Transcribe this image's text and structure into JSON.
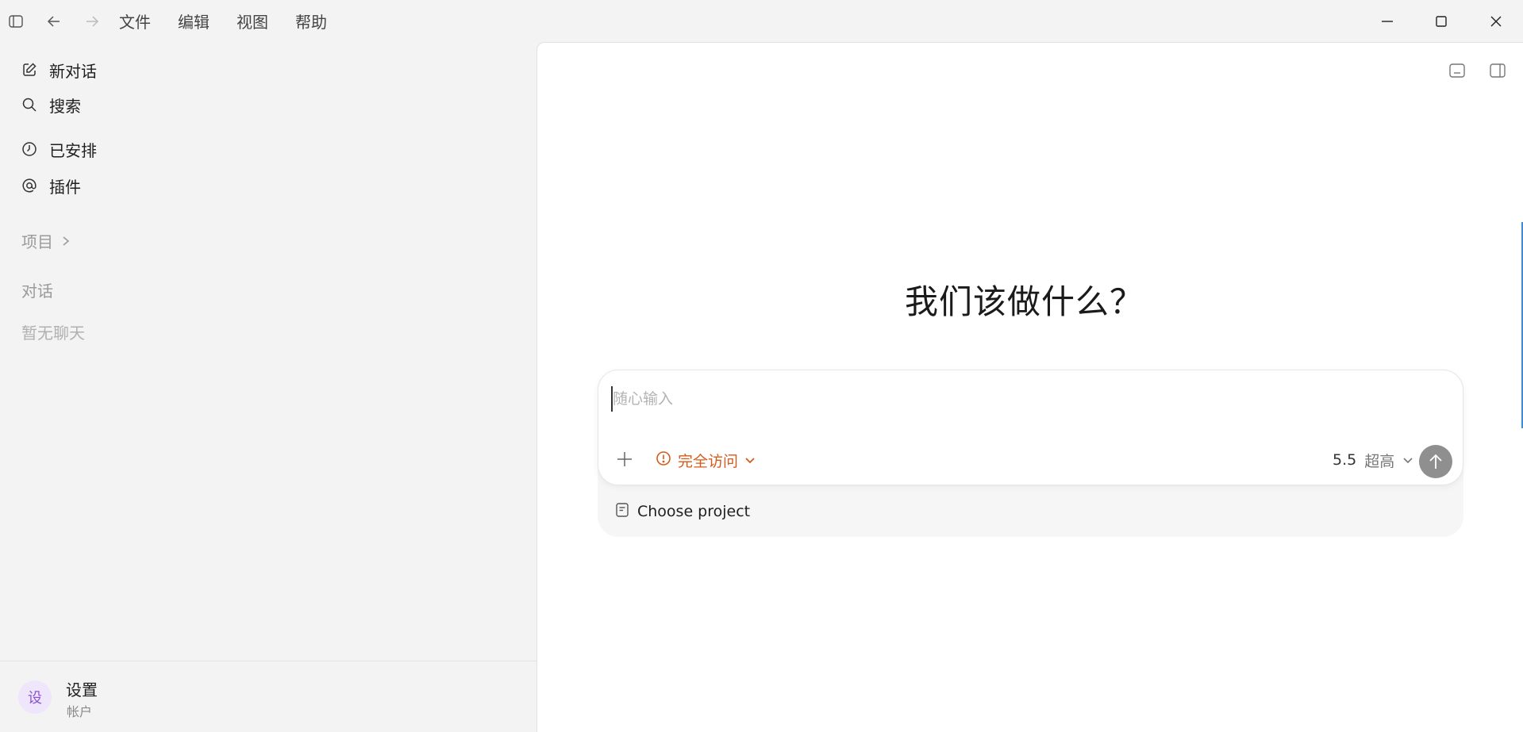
{
  "titlebar": {
    "menu": [
      "文件",
      "编辑",
      "视图",
      "帮助"
    ]
  },
  "sidebar": {
    "items": [
      {
        "label": "新对话",
        "icon": "edit-icon"
      },
      {
        "label": "搜索",
        "icon": "search-icon"
      },
      {
        "label": "已安排",
        "icon": "clock-icon"
      },
      {
        "label": "插件",
        "icon": "at-icon"
      }
    ],
    "projects_label": "项目",
    "conversations_label": "对话",
    "empty_label": "暂无聊天",
    "footer": {
      "avatar_text": "设",
      "title": "设置",
      "subtitle": "帐户"
    }
  },
  "main": {
    "heading": "我们该做什么？",
    "composer": {
      "placeholder": "随心输入",
      "access_label": "完全访问",
      "model_version": "5.5",
      "model_level": "超高",
      "project_label": "Choose project"
    }
  },
  "colors": {
    "accent_warning": "#d65a1a",
    "send_button": "#8f8f8f",
    "avatar_bg": "#efe6fb",
    "avatar_fg": "#8a54d6"
  }
}
